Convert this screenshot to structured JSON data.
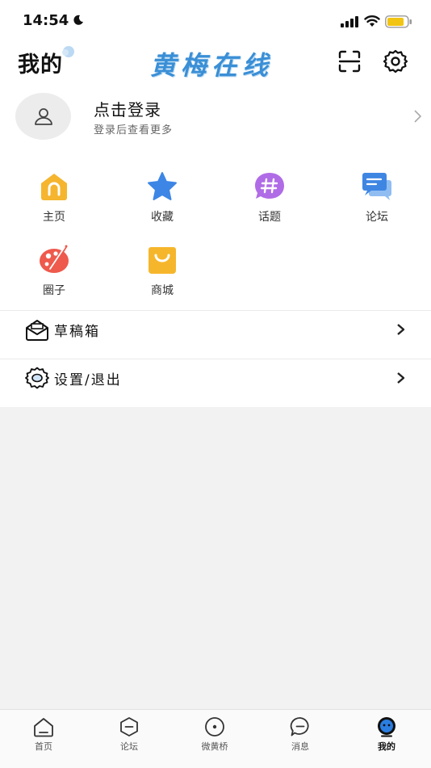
{
  "status_bar": {
    "time": "14:54"
  },
  "header": {
    "title": "我的",
    "brand": "黄梅在线"
  },
  "login": {
    "title": "点击登录",
    "subtitle": "登录后查看更多"
  },
  "grid": [
    {
      "label": "主页",
      "icon": "home-icon"
    },
    {
      "label": "收藏",
      "icon": "star-icon"
    },
    {
      "label": "话题",
      "icon": "hashtag-icon"
    },
    {
      "label": "论坛",
      "icon": "forum-icon"
    },
    {
      "label": "圈子",
      "icon": "circle-group-icon"
    },
    {
      "label": "商城",
      "icon": "shopping-bag-icon"
    }
  ],
  "list": [
    {
      "label": "草稿箱",
      "icon": "drafts-icon"
    },
    {
      "label": "设置/退出",
      "icon": "settings-icon"
    }
  ],
  "bottom_nav": [
    {
      "label": "首页",
      "icon": "home-tab-icon"
    },
    {
      "label": "论坛",
      "icon": "forum-tab-icon"
    },
    {
      "label": "微黄桥",
      "icon": "circle-tab-icon"
    },
    {
      "label": "消息",
      "icon": "message-tab-icon"
    },
    {
      "label": "我的",
      "icon": "profile-tab-icon",
      "active": true
    }
  ],
  "colors": {
    "brand": "#3a8fd6",
    "home": "#f5b52e",
    "star": "#3d86e6",
    "hashtag": "#b06ce6",
    "forum": "#3f86e3",
    "circle": "#ee5a4c",
    "shop": "#f6b62c",
    "battery": "#f2c413",
    "active_tab": "#2a7de1"
  }
}
